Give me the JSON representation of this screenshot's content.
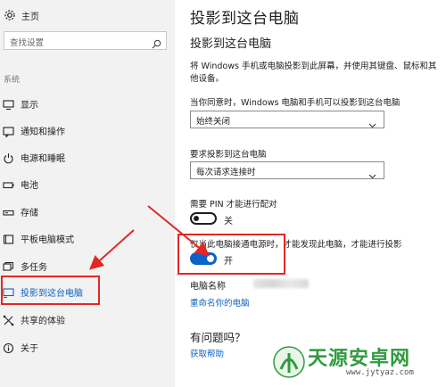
{
  "sidebar": {
    "home_label": "主页",
    "search_placeholder": "查找设置",
    "section_header": "系统",
    "items": [
      {
        "label": "显示",
        "icon": "monitor-icon"
      },
      {
        "label": "通知和操作",
        "icon": "notification-icon"
      },
      {
        "label": "电源和睡眠",
        "icon": "power-icon"
      },
      {
        "label": "电池",
        "icon": "battery-icon"
      },
      {
        "label": "存储",
        "icon": "storage-icon"
      },
      {
        "label": "平板电脑模式",
        "icon": "tablet-icon"
      },
      {
        "label": "多任务",
        "icon": "multitask-icon"
      },
      {
        "label": "投影到这台电脑",
        "icon": "project-icon",
        "active": true
      },
      {
        "label": "共享的体验",
        "icon": "shared-icon"
      },
      {
        "label": "关于",
        "icon": "info-icon"
      }
    ]
  },
  "main": {
    "title": "投影到这台电脑",
    "subtitle": "投影到这台电脑",
    "description": "将 Windows 手机或电脑投影到此屏幕，并使用其键盘、鼠标和其他设备。",
    "when_label": "当你同意时，Windows 电脑和手机可以投影到这台电脑",
    "when_value": "始终关闭",
    "ask_label": "要求投影到这台电脑",
    "ask_value": "每次请求连接时",
    "pin_label": "需要 PIN 才能进行配对",
    "pin_state": "关",
    "power_label": "仅当此电脑接通电源时，才能发现此电脑，才能进行投影",
    "power_state": "开",
    "pc_name_label": "电脑名称",
    "rename_link": "重命名你的电脑",
    "question_title": "有问题吗？",
    "help_link": "获取帮助"
  },
  "watermark": {
    "text": "天源安卓网",
    "url": "www.jytyaz.com"
  },
  "colors": {
    "accent": "#0b63c5",
    "annotation_red": "#e32722",
    "sidebar_bg": "#f2f2f2"
  }
}
